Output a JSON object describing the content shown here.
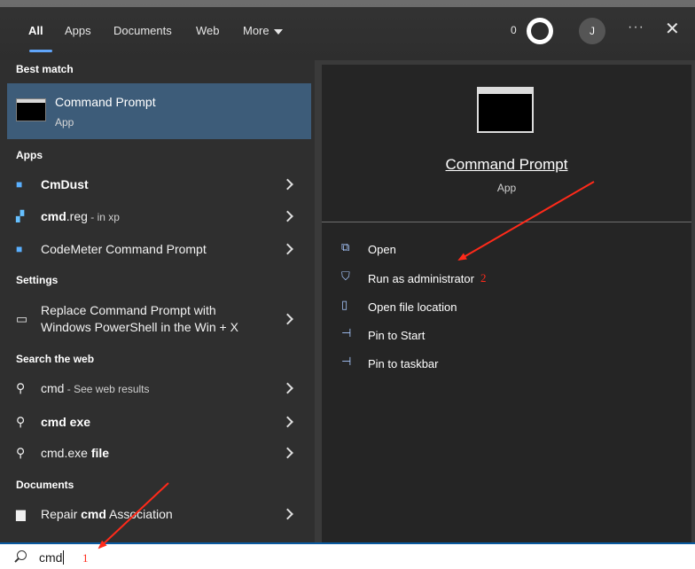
{
  "tabs": [
    {
      "label": "All",
      "active": true
    },
    {
      "label": "Apps"
    },
    {
      "label": "Documents"
    },
    {
      "label": "Web"
    },
    {
      "label": "More"
    }
  ],
  "header": {
    "points": "0",
    "avatar_initial": "J",
    "more_label": "···",
    "close_label": "✕"
  },
  "sections": {
    "best_match": "Best match",
    "apps": "Apps",
    "settings": "Settings",
    "search_web": "Search the web",
    "documents": "Documents"
  },
  "best_match": {
    "title": "Command Prompt",
    "subtitle": "App"
  },
  "apps": [
    {
      "bold": "CmDust",
      "plain": "",
      "suffix": ""
    },
    {
      "bold": "cmd",
      "plain": ".reg",
      "suffix": " - in xp"
    },
    {
      "bold": "",
      "plain": "CodeMeter Command Prompt",
      "suffix": ""
    }
  ],
  "settings": {
    "line1": "Replace Command Prompt with",
    "line2": "Windows PowerShell in the Win + X"
  },
  "web": [
    {
      "bold": "",
      "plain": "cmd",
      "suffix": " - See web results"
    },
    {
      "bold": "cmd exe",
      "plain": "",
      "suffix": ""
    },
    {
      "bold": "file",
      "plain": "cmd.exe ",
      "suffix": ""
    }
  ],
  "documents": [
    {
      "pre": "Repair ",
      "bold": "cmd",
      "post": " Association"
    }
  ],
  "preview": {
    "title": "Command Prompt",
    "subtitle": "App"
  },
  "actions": [
    {
      "label": "Open",
      "icon": "open-icon"
    },
    {
      "label": "Run as administrator",
      "icon": "shield-icon"
    },
    {
      "label": "Open file location",
      "icon": "folder-icon"
    },
    {
      "label": "Pin to Start",
      "icon": "pin-icon"
    },
    {
      "label": "Pin to taskbar",
      "icon": "pin-icon"
    }
  ],
  "search": {
    "value": "cmd"
  },
  "annotations": {
    "n1": "1",
    "n2": "2",
    "color": "#ff2a1a"
  },
  "colors": {
    "accent": "#60a5fa",
    "selected": "#3d5c79",
    "pane_left": "#2f2f2f",
    "pane_right": "#252525"
  }
}
